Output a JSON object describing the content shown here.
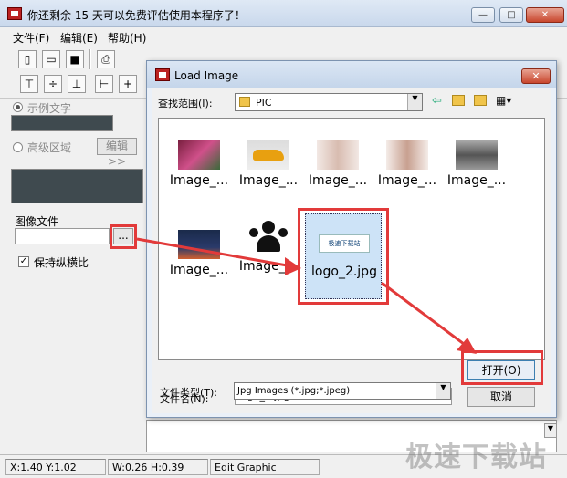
{
  "window": {
    "title": "你还剩余 15 天可以免费评估使用本程序了！",
    "min": "—",
    "max": "□",
    "close": "✕"
  },
  "menu": [
    "文件(F)",
    "编辑(E)",
    "帮助(H)"
  ],
  "left_panel": {
    "sample_text_label": "示例文字",
    "advanced_area_label": "高级区域",
    "edit_button": "编辑>>",
    "image_file_label": "图像文件",
    "browse_button": "...",
    "keep_ratio_label": "保持纵横比",
    "keep_ratio_check": "✓"
  },
  "dialog": {
    "title": "Load Image",
    "close": "✕",
    "lookin_label": "查找范围(I):",
    "lookin_value": "PIC",
    "files": [
      {
        "name": "Image_..."
      },
      {
        "name": "Image_..."
      },
      {
        "name": "Image_..."
      },
      {
        "name": "Image_..."
      },
      {
        "name": "Image_..."
      },
      {
        "name": "Image_..."
      },
      {
        "name": "Image_..."
      },
      {
        "name": "logo_2.jpg"
      }
    ],
    "thumb_logo_text": "极速下载站",
    "filename_label": "文件名(N):",
    "filename_value": "logo_2.jpg",
    "filetype_label": "文件类型(T):",
    "filetype_value": "Jpg Images (*.jpg;*.jpeg)",
    "open_button": "打开(O)",
    "cancel_button": "取消"
  },
  "status": {
    "xy": "X:1.40  Y:1.02",
    "wh": "W:0.26  H:0.39",
    "mode": "Edit Graphic"
  },
  "watermark": "极速下载站",
  "colors": {
    "red": "#e23a3a",
    "dark": "#3f4a4f"
  }
}
